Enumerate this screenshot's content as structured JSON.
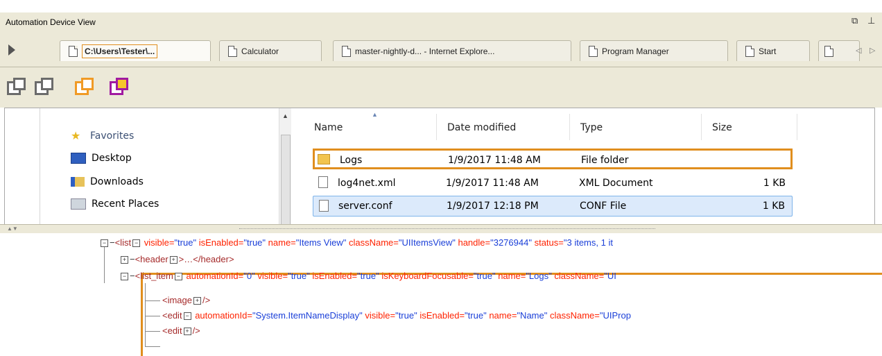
{
  "window": {
    "title": "Automation Device View",
    "controls": [
      "restore-icon",
      "pin-icon"
    ]
  },
  "tabs": [
    {
      "label": "C:\\Users\\Tester\\...",
      "active": true
    },
    {
      "label": "Calculator",
      "active": false
    },
    {
      "label": "master-nightly-d... - Internet Explore...",
      "active": false
    },
    {
      "label": "Program Manager",
      "active": false
    },
    {
      "label": "Start",
      "active": false
    }
  ],
  "toolbar": {
    "icons": [
      "window-gray-icon",
      "window-gray-icon",
      "window-orange-icon",
      "window-purple-icon"
    ]
  },
  "explorer": {
    "nav": [
      {
        "label": "Favorites",
        "icon": "star-icon"
      },
      {
        "label": "Desktop",
        "icon": "desktop-icon"
      },
      {
        "label": "Downloads",
        "icon": "downloads-icon"
      },
      {
        "label": "Recent Places",
        "icon": "recent-places-icon"
      }
    ],
    "columns": [
      "Name",
      "Date modified",
      "Type",
      "Size"
    ],
    "files": [
      {
        "name": "Logs",
        "date": "1/9/2017 11:48 AM",
        "type": "File folder",
        "size": "",
        "icon": "folder-icon",
        "state": "highlighted"
      },
      {
        "name": "log4net.xml",
        "date": "1/9/2017 11:48 AM",
        "type": "XML Document",
        "size": "1 KB",
        "icon": "xml-file-icon",
        "state": "normal"
      },
      {
        "name": "server.conf",
        "date": "1/9/2017 12:18 PM",
        "type": "CONF File",
        "size": "1 KB",
        "icon": "conf-file-icon",
        "state": "selected"
      }
    ]
  },
  "tree": {
    "list": {
      "tag": "<list",
      "a1n": "visible=",
      "a1v": "\"true\"",
      "a2n": "isEnabled=",
      "a2v": "\"true\"",
      "a3n": "name=",
      "a3v": "\"Items View\"",
      "a4n": "className=",
      "a4v": "\"UIItemsView\"",
      "a5n": "handle=",
      "a5v": "\"3276944\"",
      "a6n": "status=",
      "a6v": "\"3 items, 1 it"
    },
    "header": {
      "tag": "<header",
      "rest": ">…</header>"
    },
    "list_item": {
      "tag": "<list_item",
      "a1n": "automationId=",
      "a1v": "\"0\"",
      "a2n": "visible=",
      "a2v": "\"true\"",
      "a3n": "isEnabled=",
      "a3v": "\"true\"",
      "a4n": "isKeyboardFocusable=",
      "a4v": "\"true\"",
      "a5n": "name=",
      "a5v": "\"Logs\"",
      "a6n": "className=",
      "a6v": "\"UI"
    },
    "image": {
      "tag": "<image",
      "rest": "/>"
    },
    "edit1": {
      "tag": "<edit",
      "a1n": "automationId=",
      "a1v": "\"System.ItemNameDisplay\"",
      "a2n": "visible=",
      "a2v": "\"true\"",
      "a3n": "isEnabled=",
      "a3v": "\"true\"",
      "a4n": "name=",
      "a4v": "\"Name\"",
      "a5n": "className=",
      "a5v": "\"UIProp"
    },
    "edit2": {
      "tag": "<edit",
      "rest": "/>"
    }
  }
}
